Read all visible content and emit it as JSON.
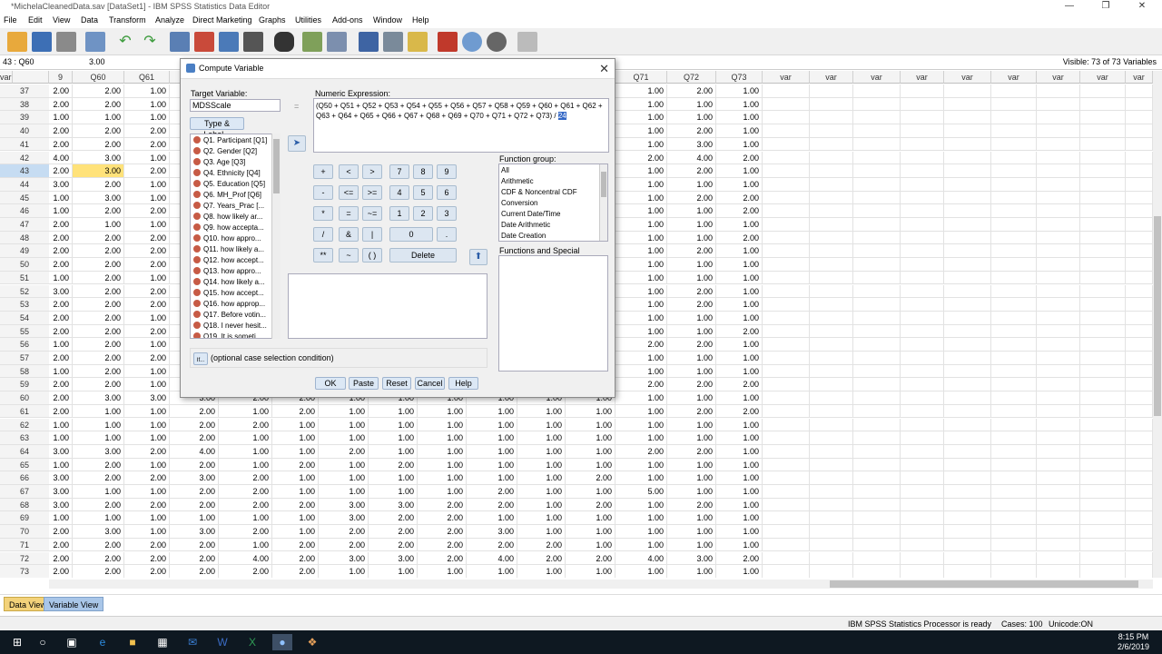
{
  "window": {
    "title": "*MichelaCleanedData.sav [DataSet1] - IBM SPSS Statistics Data Editor"
  },
  "menu": [
    "File",
    "Edit",
    "View",
    "Data",
    "Transform",
    "Analyze",
    "Direct Marketing",
    "Graphs",
    "Utilities",
    "Add-ons",
    "Window",
    "Help"
  ],
  "cellbar": {
    "ref": "43 : Q60",
    "value": "3.00",
    "visible": "Visible: 73 of 73 Variables"
  },
  "columns": {
    "left": [
      "9",
      "Q60",
      "Q61"
    ],
    "right": [
      "Q71",
      "Q72",
      "Q73",
      "var",
      "var",
      "var",
      "var",
      "var",
      "var",
      "var",
      "var",
      "var",
      "var"
    ]
  },
  "rows": [
    {
      "n": "37",
      "a": [
        "2.00",
        "2.00",
        "1.00"
      ],
      "b": [
        "1.00",
        "2.00",
        "1.00"
      ]
    },
    {
      "n": "38",
      "a": [
        "2.00",
        "2.00",
        "1.00"
      ],
      "b": [
        "1.00",
        "1.00",
        "1.00"
      ]
    },
    {
      "n": "39",
      "a": [
        "1.00",
        "1.00",
        "1.00"
      ],
      "b": [
        "1.00",
        "1.00",
        "1.00"
      ]
    },
    {
      "n": "40",
      "a": [
        "2.00",
        "2.00",
        "2.00"
      ],
      "b": [
        "1.00",
        "2.00",
        "1.00"
      ]
    },
    {
      "n": "41",
      "a": [
        "2.00",
        "2.00",
        "2.00"
      ],
      "b": [
        "1.00",
        "3.00",
        "1.00"
      ]
    },
    {
      "n": "42",
      "a": [
        "4.00",
        "3.00",
        "1.00"
      ],
      "b": [
        "2.00",
        "4.00",
        "2.00"
      ]
    },
    {
      "n": "43",
      "a": [
        "2.00",
        "3.00",
        "2.00"
      ],
      "b": [
        "1.00",
        "2.00",
        "1.00"
      ]
    },
    {
      "n": "44",
      "a": [
        "3.00",
        "2.00",
        "1.00"
      ],
      "b": [
        "1.00",
        "1.00",
        "1.00"
      ]
    },
    {
      "n": "45",
      "a": [
        "1.00",
        "3.00",
        "1.00"
      ],
      "b": [
        "1.00",
        "2.00",
        "2.00"
      ]
    },
    {
      "n": "46",
      "a": [
        "1.00",
        "2.00",
        "2.00"
      ],
      "b": [
        "1.00",
        "1.00",
        "2.00"
      ]
    },
    {
      "n": "47",
      "a": [
        "2.00",
        "1.00",
        "1.00"
      ],
      "b": [
        "1.00",
        "1.00",
        "1.00"
      ]
    },
    {
      "n": "48",
      "a": [
        "2.00",
        "2.00",
        "2.00"
      ],
      "b": [
        "1.00",
        "1.00",
        "2.00"
      ]
    },
    {
      "n": "49",
      "a": [
        "2.00",
        "2.00",
        "2.00"
      ],
      "b": [
        "1.00",
        "2.00",
        "1.00"
      ]
    },
    {
      "n": "50",
      "a": [
        "2.00",
        "2.00",
        "2.00"
      ],
      "b": [
        "1.00",
        "1.00",
        "1.00"
      ]
    },
    {
      "n": "51",
      "a": [
        "1.00",
        "2.00",
        "1.00"
      ],
      "b": [
        "1.00",
        "1.00",
        "1.00"
      ]
    },
    {
      "n": "52",
      "a": [
        "3.00",
        "2.00",
        "2.00"
      ],
      "b": [
        "1.00",
        "2.00",
        "1.00"
      ]
    },
    {
      "n": "53",
      "a": [
        "2.00",
        "2.00",
        "2.00"
      ],
      "b": [
        "1.00",
        "2.00",
        "1.00"
      ]
    },
    {
      "n": "54",
      "a": [
        "2.00",
        "2.00",
        "1.00"
      ],
      "b": [
        "1.00",
        "1.00",
        "1.00"
      ]
    },
    {
      "n": "55",
      "a": [
        "2.00",
        "2.00",
        "2.00"
      ],
      "b": [
        "1.00",
        "1.00",
        "2.00"
      ]
    },
    {
      "n": "56",
      "a": [
        "1.00",
        "2.00",
        "1.00"
      ],
      "b": [
        "2.00",
        "2.00",
        "1.00"
      ]
    },
    {
      "n": "57",
      "a": [
        "2.00",
        "2.00",
        "2.00"
      ],
      "b": [
        "1.00",
        "1.00",
        "1.00"
      ]
    },
    {
      "n": "58",
      "a": [
        "1.00",
        "2.00",
        "1.00"
      ],
      "b": [
        "1.00",
        "1.00",
        "1.00"
      ]
    },
    {
      "n": "59",
      "a": [
        "2.00",
        "2.00",
        "1.00"
      ],
      "b": [
        "2.00",
        "2.00",
        "2.00"
      ]
    },
    {
      "n": "60",
      "a": [
        "2.00",
        "3.00",
        "3.00",
        "3.00",
        "2.00",
        "2.00",
        "1.00",
        "1.00",
        "1.00",
        "1.00",
        "1.00",
        "1.00"
      ],
      "b": [
        "1.00",
        "1.00",
        "1.00"
      ]
    },
    {
      "n": "61",
      "a": [
        "2.00",
        "1.00",
        "1.00",
        "2.00",
        "1.00",
        "2.00",
        "1.00",
        "1.00",
        "1.00",
        "1.00",
        "1.00",
        "1.00"
      ],
      "b": [
        "1.00",
        "2.00",
        "2.00"
      ]
    },
    {
      "n": "62",
      "a": [
        "1.00",
        "1.00",
        "1.00",
        "2.00",
        "2.00",
        "1.00",
        "1.00",
        "1.00",
        "1.00",
        "1.00",
        "1.00",
        "1.00"
      ],
      "b": [
        "1.00",
        "1.00",
        "1.00"
      ]
    },
    {
      "n": "63",
      "a": [
        "1.00",
        "1.00",
        "1.00",
        "2.00",
        "1.00",
        "1.00",
        "1.00",
        "1.00",
        "1.00",
        "1.00",
        "1.00",
        "1.00"
      ],
      "b": [
        "1.00",
        "1.00",
        "1.00"
      ]
    },
    {
      "n": "64",
      "a": [
        "3.00",
        "3.00",
        "2.00",
        "4.00",
        "1.00",
        "1.00",
        "2.00",
        "1.00",
        "1.00",
        "1.00",
        "1.00",
        "1.00"
      ],
      "b": [
        "2.00",
        "2.00",
        "1.00"
      ]
    },
    {
      "n": "65",
      "a": [
        "1.00",
        "2.00",
        "1.00",
        "2.00",
        "1.00",
        "2.00",
        "1.00",
        "2.00",
        "1.00",
        "1.00",
        "1.00",
        "1.00"
      ],
      "b": [
        "1.00",
        "1.00",
        "1.00"
      ]
    },
    {
      "n": "66",
      "a": [
        "3.00",
        "2.00",
        "2.00",
        "3.00",
        "2.00",
        "1.00",
        "1.00",
        "1.00",
        "1.00",
        "1.00",
        "1.00",
        "2.00"
      ],
      "b": [
        "1.00",
        "1.00",
        "1.00"
      ]
    },
    {
      "n": "67",
      "a": [
        "3.00",
        "1.00",
        "1.00",
        "2.00",
        "2.00",
        "1.00",
        "1.00",
        "1.00",
        "1.00",
        "2.00",
        "1.00",
        "1.00"
      ],
      "b": [
        "5.00",
        "1.00",
        "1.00"
      ]
    },
    {
      "n": "68",
      "a": [
        "3.00",
        "2.00",
        "2.00",
        "2.00",
        "2.00",
        "2.00",
        "3.00",
        "3.00",
        "2.00",
        "2.00",
        "1.00",
        "2.00"
      ],
      "b": [
        "1.00",
        "2.00",
        "1.00"
      ]
    },
    {
      "n": "69",
      "a": [
        "1.00",
        "1.00",
        "1.00",
        "1.00",
        "1.00",
        "1.00",
        "3.00",
        "2.00",
        "2.00",
        "1.00",
        "1.00",
        "1.00"
      ],
      "b": [
        "1.00",
        "1.00",
        "1.00"
      ]
    },
    {
      "n": "70",
      "a": [
        "2.00",
        "3.00",
        "1.00",
        "3.00",
        "2.00",
        "1.00",
        "2.00",
        "2.00",
        "2.00",
        "3.00",
        "1.00",
        "1.00"
      ],
      "b": [
        "1.00",
        "1.00",
        "1.00"
      ]
    },
    {
      "n": "71",
      "a": [
        "2.00",
        "2.00",
        "2.00",
        "2.00",
        "1.00",
        "2.00",
        "2.00",
        "2.00",
        "2.00",
        "2.00",
        "2.00",
        "1.00"
      ],
      "b": [
        "1.00",
        "1.00",
        "1.00"
      ]
    },
    {
      "n": "72",
      "a": [
        "2.00",
        "2.00",
        "2.00",
        "2.00",
        "4.00",
        "2.00",
        "3.00",
        "3.00",
        "2.00",
        "4.00",
        "2.00",
        "2.00"
      ],
      "b": [
        "4.00",
        "3.00",
        "2.00"
      ]
    },
    {
      "n": "73",
      "a": [
        "2.00",
        "2.00",
        "2.00",
        "2.00",
        "2.00",
        "2.00",
        "1.00",
        "1.00",
        "1.00",
        "1.00",
        "1.00",
        "1.00"
      ],
      "b": [
        "1.00",
        "1.00",
        "1.00"
      ]
    }
  ],
  "tabs": {
    "data_view": "Data View",
    "variable_view": "Variable View"
  },
  "status": {
    "processor": "IBM SPSS Statistics Processor is ready",
    "cases": "Cases: 100",
    "unicode": "Unicode:ON"
  },
  "clock": {
    "time": "8:15 PM",
    "date": "2/6/2019"
  },
  "dialog": {
    "title": "Compute Variable",
    "target_label": "Target Variable:",
    "target_value": "MDSScale",
    "equals": "=",
    "type_label_btn": "Type & Label...",
    "expr_label": "Numeric Expression:",
    "expr_text": "(Q50 + Q51 + Q52 + Q53 + Q54 + Q55 + Q56 + Q57 + Q58 + Q59 + Q60 + Q61 + Q62 + Q63 + Q64 + Q65 + Q66 + Q67 + Q68 + Q69 + Q70 + Q71 + Q72 + Q73) / ",
    "expr_selected": "24",
    "variables": [
      "Q1. Participant [Q1]",
      "Q2. Gender [Q2]",
      "Q3. Age [Q3]",
      "Q4. Ethnicity [Q4]",
      "Q5. Education [Q5]",
      "Q6. MH_Prof [Q6]",
      "Q7. Years_Prac [...",
      "Q8.  how likely ar...",
      "Q9.  how accepta...",
      "Q10.  how appro...",
      "Q11.  how likely a...",
      "Q12.  how accept...",
      "Q13.  how appro...",
      "Q14.  how likely a...",
      "Q15. how accept...",
      "Q16. how approp...",
      "Q17. Before votin...",
      "Q18. I never hesit...",
      "Q19. It is someti..."
    ],
    "keypad": [
      "+",
      "<",
      ">",
      "7",
      "8",
      "9",
      "-",
      "<=",
      ">=",
      "4",
      "5",
      "6",
      "*",
      "=",
      "~=",
      "1",
      "2",
      "3",
      "/",
      "&",
      "|",
      "0",
      ".",
      "**",
      "~",
      "( )",
      "Delete"
    ],
    "function_group_label": "Function group:",
    "function_groups": [
      "All",
      "Arithmetic",
      "CDF & Noncentral CDF",
      "Conversion",
      "Current Date/Time",
      "Date Arithmetic",
      "Date Creation"
    ],
    "functions_label": "Functions and Special Variables:",
    "if_btn": "If...",
    "if_text": "(optional case selection condition)",
    "buttons": {
      "ok": "OK",
      "paste": "Paste",
      "reset": "Reset",
      "cancel": "Cancel",
      "help": "Help"
    }
  }
}
